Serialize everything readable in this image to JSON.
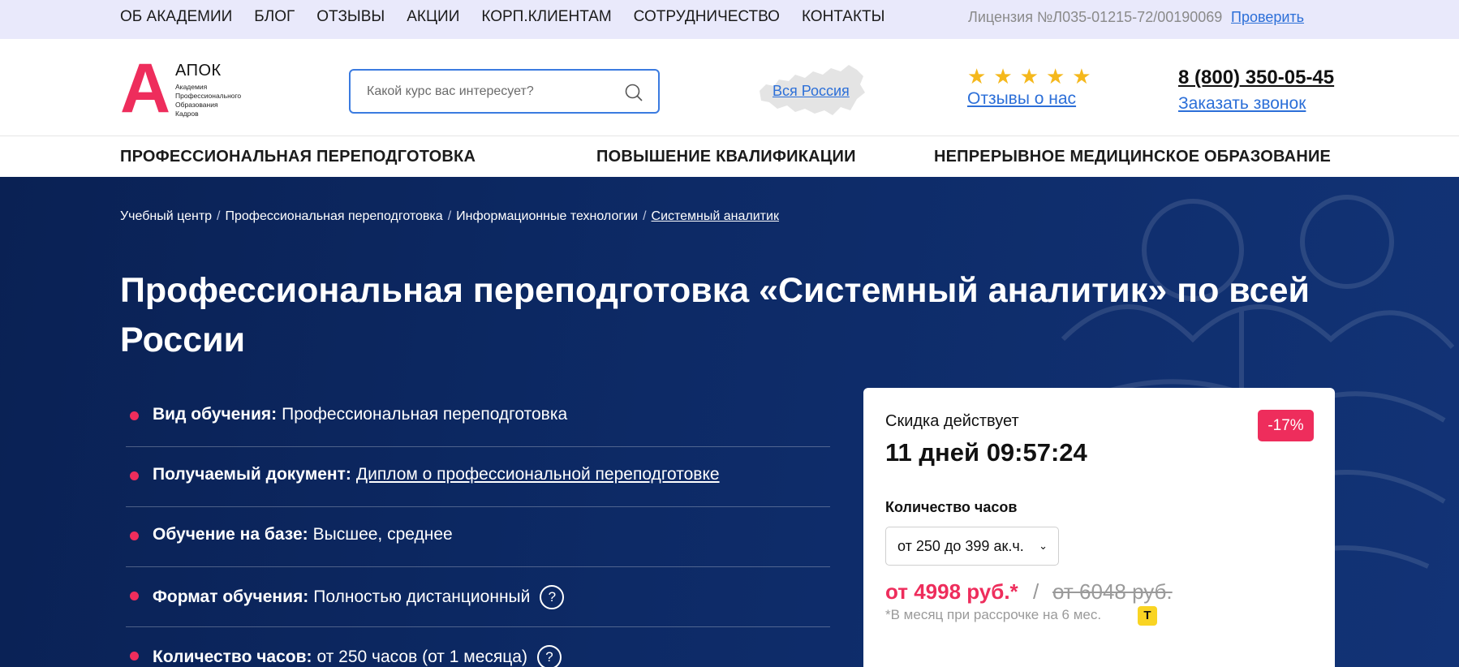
{
  "topbar": {
    "nav": [
      "ОБ АКАДЕМИИ",
      "БЛОГ",
      "ОТЗЫВЫ",
      "АКЦИИ",
      "КОРП.КЛИЕНТАМ",
      "СОТРУДНИЧЕСТВО",
      "КОНТАКТЫ"
    ],
    "license": "Лицензия №Л035-01215-72/00190069",
    "check_label": "Проверить"
  },
  "header": {
    "logo_letter": "А",
    "logo_title": "АПОК",
    "logo_subtitle_lines": [
      "Академия",
      "Профессионального",
      "Образования",
      "Кадров"
    ],
    "search_placeholder": "Какой курс вас интересует?",
    "region_label": "Вся Россия",
    "stars": 5,
    "reviews_label": "Отзывы о нас",
    "phone": "8 (800) 350-05-45",
    "callback_label": "Заказать звонок",
    "colors": {
      "brand": "#ee2d5c",
      "link": "#2c6fd8",
      "star": "#f5b81c"
    }
  },
  "mainnav": [
    "ПРОФЕССИОНАЛЬНАЯ ПЕРЕПОДГОТОВКА",
    "ПОВЫШЕНИЕ КВАЛИФИКАЦИИ",
    "НЕПРЕРЫВНОЕ МЕДИЦИНСКОЕ ОБРАЗОВАНИЕ"
  ],
  "hero": {
    "breadcrumbs": [
      "Учебный центр",
      "Профессиональная переподготовка",
      "Информационные технологии",
      "Системный аналитик"
    ],
    "title": "Профессиональная переподготовка «Системный аналитик» по всей России",
    "facts": [
      {
        "label": "Вид обучения:",
        "value": "Профессиональная переподготовка"
      },
      {
        "label": "Получаемый документ:",
        "value": "Диплом о профессиональной переподготовке"
      },
      {
        "label": "Обучение на базе:",
        "value": "Высшее, среднее"
      },
      {
        "label": "Формат обучения:",
        "value": "Полностью дистанционный"
      },
      {
        "label": "Количество часов:",
        "value": "от 250 часов (от 1 месяца)"
      }
    ],
    "help_glyph": "?",
    "background_color": "#0d2a66"
  },
  "card": {
    "discount_label": "Скидка действует",
    "discount_badge": "-17%",
    "timer": "11 дней 09:57:24",
    "hours_label": "Количество часов",
    "hours_selected": "от 250 до 399 ак.ч.",
    "price": "от 4998 руб.*",
    "price_separator": "/",
    "old_price": "от 6048 руб.",
    "installment_note": "*В месяц при рассрочке на 6 мес.",
    "bank_badge": "Т"
  }
}
